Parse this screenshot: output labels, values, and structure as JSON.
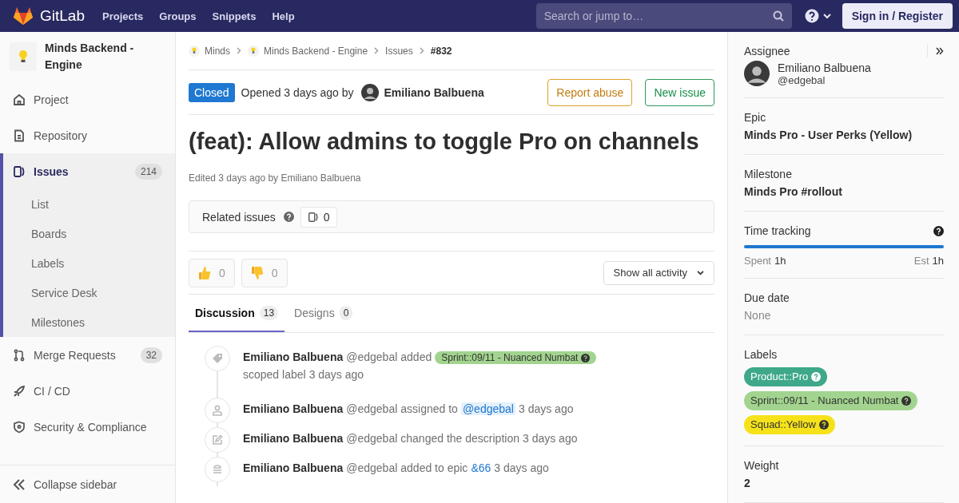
{
  "header": {
    "logo_text": "GitLab",
    "nav": [
      "Projects",
      "Groups",
      "Snippets",
      "Help"
    ],
    "search": {
      "placeholder": "Search or jump to…"
    },
    "sign_in": "Sign in / Register"
  },
  "sidebar": {
    "project": "Minds Backend - Engine",
    "items": [
      {
        "label": "Project",
        "selected": false
      },
      {
        "label": "Repository",
        "selected": false
      },
      {
        "label": "Issues",
        "count": "214",
        "selected": true,
        "expanded": true,
        "children": [
          {
            "label": "List"
          },
          {
            "label": "Boards"
          },
          {
            "label": "Labels"
          },
          {
            "label": "Service Desk"
          },
          {
            "label": "Milestones"
          }
        ]
      },
      {
        "label": "Merge Requests",
        "count": "32",
        "selected": false
      },
      {
        "label": "CI / CD",
        "selected": false
      },
      {
        "label": "Security & Compliance",
        "selected": false
      }
    ],
    "collapse": "Collapse sidebar"
  },
  "breadcrumbs": [
    "Minds",
    "Minds Backend - Engine",
    "Issues",
    "#832"
  ],
  "issue": {
    "status": "Closed",
    "opened": "Opened 3 days ago by",
    "author": "Emiliano Balbuena",
    "buttons": [
      "Report abuse",
      "New issue"
    ],
    "title": "(feat): Allow admins to toggle Pro on channels",
    "edited": "Edited 3 days ago by Emiliano Balbuena",
    "related": {
      "label": "Related issues",
      "count": "0"
    },
    "reactions": [
      {
        "count": "0"
      },
      {
        "count": "0"
      }
    ],
    "activity_filter": "Show all activity",
    "tabs": [
      {
        "label": "Discussion",
        "count": "13",
        "selected": true
      },
      {
        "label": "Designs",
        "count": "0",
        "selected": false
      }
    ],
    "activities": [
      {
        "author": "Emiliano Balbuena",
        "handle": "@edgebal",
        "parts": [
          {
            "kind": "text",
            "text": "added"
          },
          {
            "kind": "label",
            "text": "Sprint::09/11 - Nuanced Numbat",
            "color": "#a2d48f"
          },
          {
            "kind": "text",
            "text": "scoped label"
          }
        ],
        "time": "3 days ago"
      },
      {
        "author": "Emiliano Balbuena",
        "handle": "@edgebal",
        "parts": [
          {
            "kind": "text",
            "text": "assigned to"
          },
          {
            "kind": "mention",
            "text": "@edgebal"
          }
        ],
        "time": "3 days ago"
      },
      {
        "author": "Emiliano Balbuena",
        "handle": "@edgebal",
        "parts": [
          {
            "kind": "text",
            "text": "changed the description"
          }
        ],
        "time": "3 days ago"
      },
      {
        "author": "Emiliano Balbuena",
        "handle": "@edgebal",
        "parts": [
          {
            "kind": "text",
            "text": "added to epic"
          },
          {
            "kind": "link",
            "text": "&66"
          }
        ],
        "time": "3 days ago"
      }
    ]
  },
  "right_sidebar": {
    "assignee": {
      "label": "Assignee",
      "name": "Emiliano Balbuena",
      "handle": "@edgebal"
    },
    "epic": {
      "label": "Epic",
      "value": "Minds Pro - User Perks (Yellow)"
    },
    "milestone": {
      "label": "Milestone",
      "value": "Minds Pro #rollout"
    },
    "time_tracking": {
      "label": "Time tracking",
      "level": 1,
      "spent_label": "Spent",
      "spent": "1h",
      "est_label": "Est",
      "est": "1h"
    },
    "due_date": {
      "label": "Due date",
      "value": "None"
    },
    "labels": {
      "label": "Labels",
      "items": [
        {
          "text": "Product::Pro",
          "color": "#3fa88a"
        },
        {
          "text": "Sprint::09/11 - Nuanced Numbat",
          "color": "#a2d48f"
        },
        {
          "text": "Squad::Yellow",
          "color": "#f5e21b"
        }
      ]
    },
    "weight": {
      "label": "Weight",
      "value": "2"
    }
  }
}
